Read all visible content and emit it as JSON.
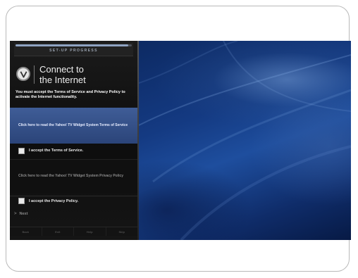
{
  "setup": {
    "progress_label": "SET-UP PROGRESS",
    "progress_value": 0.97,
    "title_line1": "Connect to",
    "title_line2": "the Internet",
    "intro": "You must accept the Terms of Service and Privacy Policy to activate the Internet functionality.",
    "tos_link": "Click here to read the Yahoo! TV Widget System Terms of Service",
    "tos_checkbox_label": "I accept the Terms of Service.",
    "privacy_link": "Click here to read the Yahoo! TV Widget System Privacy Policy",
    "privacy_checkbox_label": "I accept the Privacy Policy.",
    "next_label": "Next",
    "nav": [
      "Back",
      "Exit",
      "Help",
      "Skip"
    ]
  },
  "icons": {
    "logo": "vizio-v-logo",
    "next": "chevron-right-icon"
  },
  "colors": {
    "highlight": "#3f5d97",
    "panel_bg": "#141414",
    "background_blue": "#143a82"
  }
}
